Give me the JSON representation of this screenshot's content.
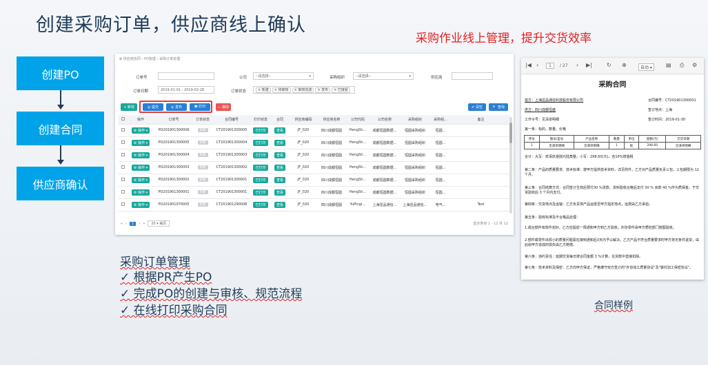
{
  "slide": {
    "title": "创建采购订单，供应商线上确认",
    "subtitle": "采购作业线上管理，提升交货效率"
  },
  "flow": [
    "创建PO",
    "创建合同",
    "供应商确认"
  ],
  "app": {
    "breadcrumb": "✿ 供应商协同 › PO管理 › 采购订单处理",
    "form": {
      "order_no_label": "订单号",
      "company_label": "公司",
      "company_value": "--请选择--",
      "purchase_org_label": "采购组织",
      "purchase_org_value": "--请选择--",
      "supplier_label": "供应商",
      "order_date_label": "订单日期",
      "order_date_value": "2019-01-01 - 2019-02-28",
      "order_status_label": "订单状态",
      "status_chips": [
        "× 新建",
        "× 待审核",
        "× 审核完成",
        "× 发布",
        "× 已接受"
      ]
    },
    "toolbar": {
      "add": "+ 新增",
      "submit": "◎ 提交",
      "publish": "◎ 发布",
      "print": "🖶 打印",
      "delete": "— 删除",
      "clear": "✐ 清空",
      "search": "🔍 查询"
    },
    "columns": [
      "",
      "操作",
      "订单号",
      "订单状态",
      "合同编号",
      "打印状态",
      "合同",
      "供应商编码",
      "供应商名称",
      "公司代码",
      "公司名称",
      "采购组织",
      "采购组...",
      "备注"
    ],
    "op_label": "⚙ 操作 ▾",
    "status_tag": "新建",
    "print_tag": "已打印",
    "view_label": "查看",
    "rows": [
      {
        "po": "PO201901300006",
        "contract": "CT201901300005",
        "vcode": "JF_020",
        "vname": "四川成都恒圆",
        "ccode": "HengSh...",
        "cname": "成都恒圆数据...",
        "org": "恒圆采购组织",
        "org2": "恒圆...",
        "note": ""
      },
      {
        "po": "PO201901300005",
        "contract": "CT201901300004",
        "vcode": "JF_020",
        "vname": "四川成都恒圆",
        "ccode": "HengSh...",
        "cname": "成都恒圆数据...",
        "org": "恒圆采购组织",
        "org2": "恒圆...",
        "note": ""
      },
      {
        "po": "PO201901300004",
        "contract": "CT201901300003",
        "vcode": "JF_020",
        "vname": "四川成都恒圆",
        "ccode": "HengSh...",
        "cname": "成都恒圆数据...",
        "org": "恒圆采购组织",
        "org2": "恒圆...",
        "note": ""
      },
      {
        "po": "PO201901300003",
        "contract": "CT201901300002",
        "vcode": "JF_020",
        "vname": "四川成都恒圆",
        "ccode": "HengSh...",
        "cname": "成都恒圆数据...",
        "org": "恒圆采购组织",
        "org2": "恒圆...",
        "note": ""
      },
      {
        "po": "PO201901300002",
        "contract": "CT201901300001",
        "vcode": "JF_020",
        "vname": "四川成都恒圆",
        "ccode": "HengSh...",
        "cname": "成都恒圆数据...",
        "org": "恒圆采购组织",
        "org2": "恒圆...",
        "note": ""
      },
      {
        "po": "PO201901300001",
        "contract": "CT201901300001",
        "vcode": "JF_020",
        "vname": "四川成都恒圆",
        "ccode": "HengSh...",
        "cname": "成都恒圆数据...",
        "org": "恒圆采购组织",
        "org2": "恒圆...",
        "note": ""
      },
      {
        "po": "PO201901070005",
        "contract": "CT201901290008",
        "vcode": "JF_020",
        "vname": "四川成都恒圆",
        "ccode": "YuPing(...",
        "cname": "上海昱品通信...",
        "org": "上海昱品通信...",
        "org2": "电气...",
        "note": "Test"
      }
    ],
    "pager": {
      "first": "«",
      "prev": "‹",
      "page": "1",
      "next": "›",
      "last": "»",
      "size": "20",
      "size_suffix": "▾ 每页",
      "info": "显示条目 1 - 12 共 12"
    }
  },
  "bullets": {
    "title": "采购订单管理",
    "items": [
      "✓ 根据PR产生PO",
      "✓ 完成PO的创建与审核、规范流程",
      "✓ 在线打印采购合同"
    ]
  },
  "contract": {
    "toolbar": {
      "page": "1",
      "total": "/ 27",
      "zoom": "自动 ▾"
    },
    "title": "采购合同",
    "buyer": "需方：上海昱品通信科技股份有限公司",
    "contract_no": "合同编号：CT201901300001",
    "supplier": "供方：四川成都恒盛",
    "sign_place": "签订地点：上海",
    "work_order": "工作令号：见清单明细",
    "sign_date": "签订时间：2019-01-30",
    "clause1": "第一条：标的、数量、价格",
    "table_headers": [
      "序号",
      "图号/型号",
      "产品名称",
      "数量",
      "单位",
      "金额(元)",
      "交货日期"
    ],
    "table_row": [
      "1",
      "见清单明细",
      "见清单明细",
      "1",
      "批",
      "298.60",
      "见清单明细"
    ],
    "total": "合计：大写：贰佰玖拾捌元陆角整，小写：298.60(元)，含16%增值税",
    "clause2": "第二条：产品的质量要求、技术标准：按甲方提供技术资料，详见附件，乙方对产品质量负责三包，三包期限为 12 个月。",
    "clause3": "第三条：合同结算方式：合同签订生效后预付30 %货款，货到验收合格后支付 30 % 余款 40 %作为质保金，于交货验收后 3 个月内支付。",
    "clause4": "第四条：交货地点及运输：乙方负责将产品运抵至甲方指定地点，运费由乙方承担。",
    "clause5": "第五条：验收标准及不合格品处理：",
    "clause5a": "1.成台部件有效件完好，乙方应提前一周通知甲方到乙方验收，外协零件由甲方质检部门按图验收。",
    "clause5b": "2.部件或零件出现小的质量问题需在接到通知后3天内予以解决，乙方产品不符合质量要求时甲方将无条件退货，由此给甲方造成的损失由乙方赔偿。",
    "clause6": "第六条：违约责任：延期交货每日按合同金额 3 %计算，在货款中直接扣除。",
    "clause7": "第七条：技术资料及保密：乙方向甲方保证，严格遵守双方签订的\"外协加工质量协议\"及\"委托加工保密协议\"。"
  },
  "caption": "合同样例"
}
